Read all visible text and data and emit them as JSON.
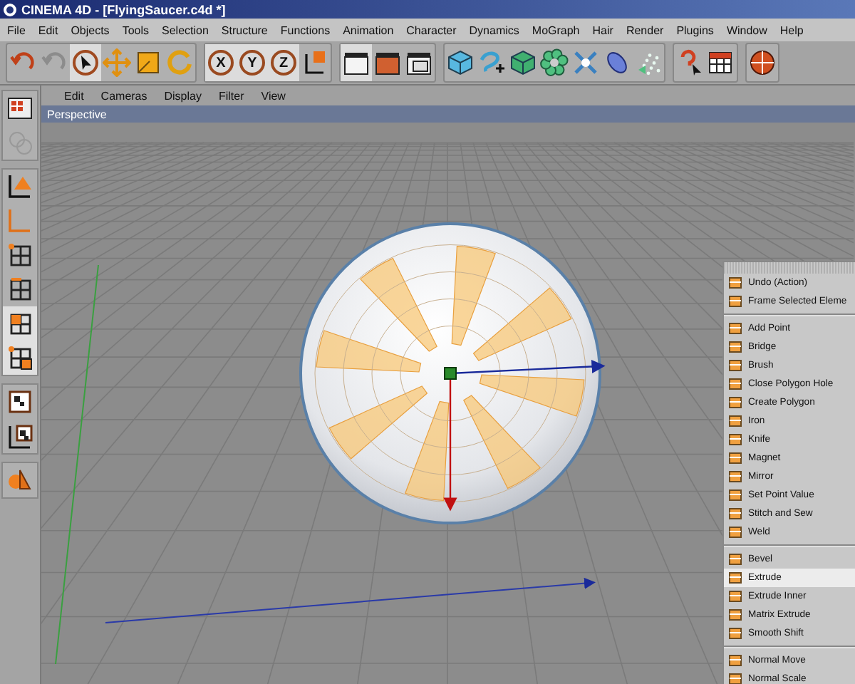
{
  "window": {
    "title": "CINEMA 4D - [FlyingSaucer.c4d *]"
  },
  "menu_bar": [
    "File",
    "Edit",
    "Objects",
    "Tools",
    "Selection",
    "Structure",
    "Functions",
    "Animation",
    "Character",
    "Dynamics",
    "MoGraph",
    "Hair",
    "Render",
    "Plugins",
    "Window",
    "Help"
  ],
  "toolbar": [
    [
      {
        "kind": "undo",
        "selected": false
      },
      {
        "kind": "redo",
        "selected": false
      },
      {
        "kind": "select",
        "selected": true
      },
      {
        "kind": "move",
        "selected": false
      },
      {
        "kind": "scale",
        "selected": false
      },
      {
        "kind": "rotate",
        "selected": false
      }
    ],
    [
      {
        "kind": "axis-lock",
        "label": "X",
        "selected": true
      },
      {
        "kind": "axis-lock",
        "label": "Y",
        "selected": true
      },
      {
        "kind": "axis-lock",
        "label": "Z",
        "selected": true
      },
      {
        "kind": "coordinates",
        "selected": false
      }
    ],
    [
      {
        "kind": "render-view",
        "selected": true
      },
      {
        "kind": "render",
        "selected": false
      },
      {
        "kind": "render-manager",
        "selected": false
      }
    ],
    [
      {
        "kind": "cube",
        "selected": false
      },
      {
        "kind": "spline",
        "selected": false
      },
      {
        "kind": "subdivision",
        "selected": false
      },
      {
        "kind": "array",
        "selected": false
      },
      {
        "kind": "deformer",
        "selected": false
      },
      {
        "kind": "environment",
        "selected": false
      },
      {
        "kind": "particles",
        "selected": false
      }
    ],
    [
      {
        "kind": "help",
        "selected": false
      },
      {
        "kind": "table",
        "selected": false
      }
    ],
    [
      {
        "kind": "globe",
        "selected": false
      }
    ]
  ],
  "left_toolbar": [
    [
      {
        "kind": "model",
        "selected": false
      },
      {
        "kind": "texture-faded",
        "selected": false
      }
    ],
    [
      {
        "kind": "object-axis",
        "selected": false
      },
      {
        "kind": "axis",
        "selected": false
      },
      {
        "kind": "points",
        "selected": false
      },
      {
        "kind": "edges",
        "selected": false
      },
      {
        "kind": "polygons",
        "selected": true
      },
      {
        "kind": "uv-points",
        "selected": true
      }
    ],
    [
      {
        "kind": "texture",
        "selected": false
      },
      {
        "kind": "texture-axis",
        "selected": false
      }
    ],
    [
      {
        "kind": "sculpt",
        "selected": false
      }
    ]
  ],
  "viewport": {
    "menu": [
      "Edit",
      "Cameras",
      "Display",
      "Filter",
      "View"
    ],
    "title": "Perspective"
  },
  "context_menu": [
    [
      {
        "label": "Undo (Action)",
        "selected": false
      },
      {
        "label": "Frame Selected Eleme",
        "selected": false
      }
    ],
    [
      {
        "label": "Add Point",
        "selected": false
      },
      {
        "label": "Bridge",
        "selected": false
      },
      {
        "label": "Brush",
        "selected": false
      },
      {
        "label": "Close Polygon Hole",
        "selected": false
      },
      {
        "label": "Create Polygon",
        "selected": false
      },
      {
        "label": "Iron",
        "selected": false
      },
      {
        "label": "Knife",
        "selected": false
      },
      {
        "label": "Magnet",
        "selected": false
      },
      {
        "label": "Mirror",
        "selected": false
      },
      {
        "label": "Set Point Value",
        "selected": false
      },
      {
        "label": "Stitch and Sew",
        "selected": false
      },
      {
        "label": "Weld",
        "selected": false
      }
    ],
    [
      {
        "label": "Bevel",
        "selected": false
      },
      {
        "label": "Extrude",
        "selected": true
      },
      {
        "label": "Extrude Inner",
        "selected": false
      },
      {
        "label": "Matrix Extrude",
        "selected": false
      },
      {
        "label": "Smooth Shift",
        "selected": false
      }
    ],
    [
      {
        "label": "Normal Move",
        "selected": false
      },
      {
        "label": "Normal Scale",
        "selected": false
      }
    ]
  ]
}
